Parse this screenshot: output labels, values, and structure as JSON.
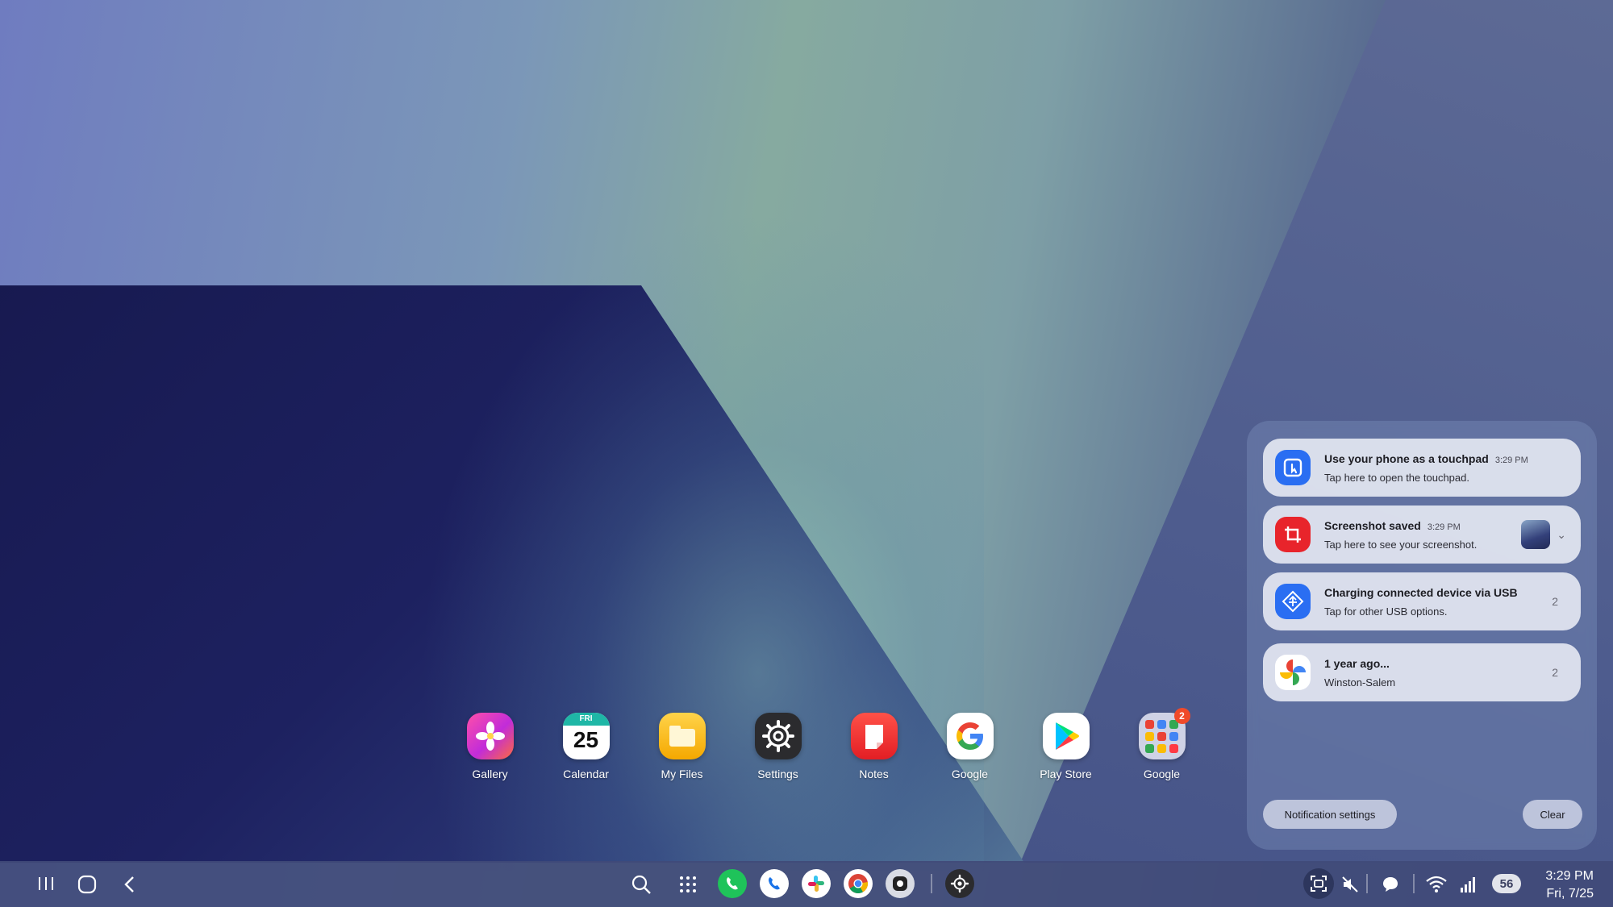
{
  "dock": {
    "apps": [
      {
        "label": "Gallery"
      },
      {
        "label": "Calendar",
        "day_name": "FRI",
        "day_number": "25"
      },
      {
        "label": "My Files"
      },
      {
        "label": "Settings"
      },
      {
        "label": "Notes"
      },
      {
        "label": "Google"
      },
      {
        "label": "Play Store"
      },
      {
        "label": "Google",
        "badge": "2"
      }
    ]
  },
  "notifications": {
    "items": [
      {
        "title": "Use your phone as a touchpad",
        "time": "3:29 PM",
        "subtitle": "Tap here to open the touchpad."
      },
      {
        "title": "Screenshot saved",
        "time": "3:29 PM",
        "subtitle": "Tap here to see your screenshot."
      },
      {
        "title": "Charging connected device via USB",
        "subtitle": "Tap for other USB options.",
        "count": "2"
      },
      {
        "title": "1 year ago...",
        "subtitle": "Winston-Salem",
        "count": "2"
      }
    ],
    "settings_label": "Notification settings",
    "clear_label": "Clear"
  },
  "taskbar": {
    "battery": "56",
    "time": "3:29 PM",
    "date": "Fri, 7/25"
  },
  "colors": {
    "taskbar": "#404a78",
    "touchpad_icon": "#2a6ef2",
    "screenshot_icon": "#e8242b",
    "usb_icon": "#2a6ef2"
  }
}
